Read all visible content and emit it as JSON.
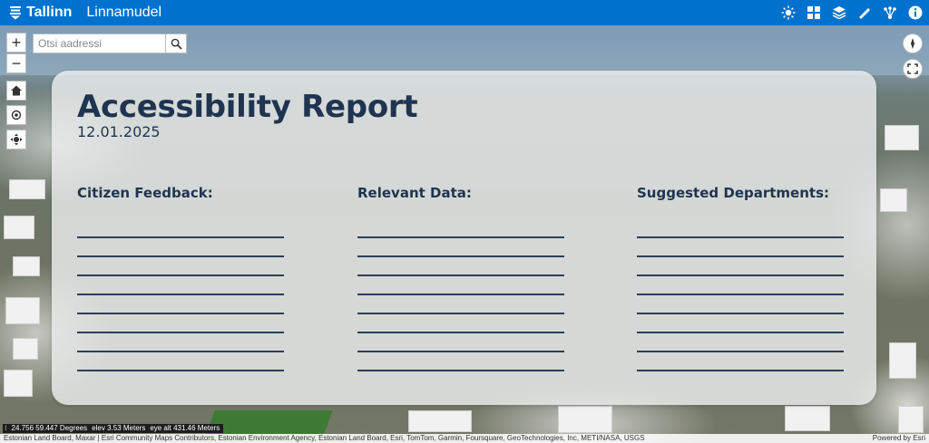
{
  "header": {
    "brand": "Tallinn",
    "app_name": "Linnamudel",
    "tools": [
      "daylight-icon",
      "basemap-gallery-icon",
      "layers-icon",
      "measure-icon",
      "analysis-icon",
      "info-icon"
    ]
  },
  "search": {
    "placeholder": "Otsi aadressi"
  },
  "map_controls": {
    "zoom_in": "+",
    "zoom_out": "−"
  },
  "report": {
    "title": "Accessibility Report",
    "date": "12.01.2025",
    "columns": [
      {
        "heading": "Citizen Feedback:"
      },
      {
        "heading": "Relevant Data:"
      },
      {
        "heading": "Suggested Departments:"
      }
    ]
  },
  "status": {
    "coordinates": "24.756 59.447 Degrees",
    "elevation": "elev 3.53 Meters",
    "eye_altitude": "eye alt 431.46 Meters"
  },
  "attribution": {
    "text": "Estonian Land Board, Maxar | Esri Community Maps Contributors, Estonian Environment Agency, Estonian Land Board, Esri, TomTom, Garmin, Foursquare, GeoTechnologies, Inc, METI/NASA, USGS",
    "powered_by": "Powered by Esri"
  },
  "colors": {
    "topbar": "#0072ce",
    "report_text": "#1e3450"
  }
}
